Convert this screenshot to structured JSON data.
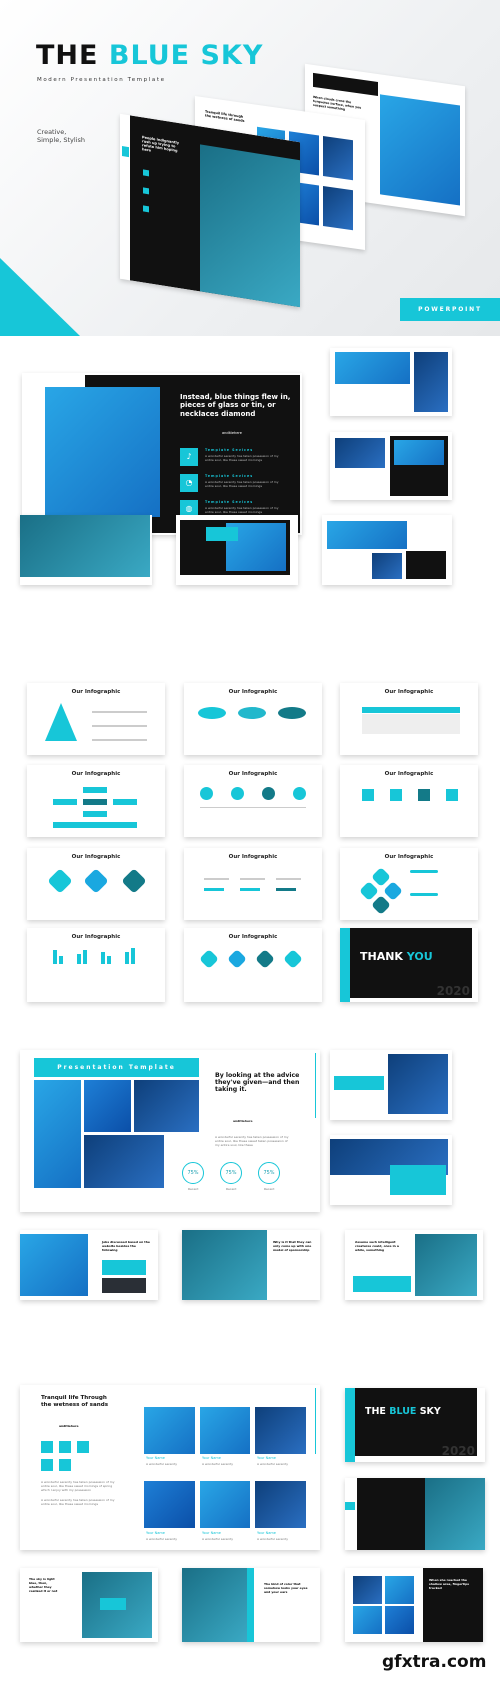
{
  "hero": {
    "title_part1": "THE",
    "title_part2": "BLUE SKY",
    "subtitle": "Modern Presentation Template",
    "tagline_line1": "Creative,",
    "tagline_line2": "Simple, Stylish",
    "badge": "POWERPOINT",
    "preview_slide_1_heading": "People indignantly rush up trying to refute him hoping here",
    "preview_slide_2_heading": "Tranquil life through the wetness of sands",
    "preview_slide_3_heading": "When clouds cross the turquoise surface, when you suspect something"
  },
  "colors": {
    "accent": "#17c6d8",
    "dark": "#111111",
    "photo_blue": "#1e7fd6"
  },
  "section2": {
    "heading": "Instead, blue things flew in, pieces of glass or tin, or necklaces diamond",
    "brand": "anditiehere",
    "services": [
      {
        "title": "Template Sevices",
        "text": "A wonderful serenity has taken possession of my entire soul, like these sweet mornings",
        "icon": "bell-icon"
      },
      {
        "title": "Template Sevices",
        "text": "A wonderful serenity has taken possession of my entire soul, like these sweet mornings",
        "icon": "pie-chart-icon"
      },
      {
        "title": "Template Sevices",
        "text": "A wonderful serenity has taken possession of my entire soul, like these sweet mornings",
        "icon": "globe-icon"
      }
    ]
  },
  "infographics": {
    "title": "Our Infographic",
    "thank_you_1": "THANK",
    "thank_you_2": "YOU",
    "year": "2020"
  },
  "section4": {
    "banner": "Presentation Template",
    "heading": "By looking at the advice they've given—and then taking it.",
    "brand": "anditiehere",
    "body": "A wonderful serenity has taken possession of my entire soul, like these sweet taken possession of my entire soul, like these",
    "stats": [
      {
        "value": "75%",
        "label": "Recent"
      },
      {
        "value": "75%",
        "label": "Recent"
      },
      {
        "value": "75%",
        "label": "Recent"
      }
    ],
    "row_headings": [
      "Jobs discussed based on the website besides the following",
      "Why is it that they can only come up with one model of sponsorship",
      "Assume such intelligent creatures could, once in a while, something"
    ]
  },
  "section5": {
    "heading": "Tranquil life Through the wetness of sands",
    "brand": "anditiehere",
    "body1": "A wonderful serenity has taken possession of my entire soul, like these sweet mornings of spring which I enjoy with my possession",
    "body2": "A wonderful serenity has taken possession of my entire soul, like these sweet mornings",
    "team": [
      {
        "name": "Your Name",
        "role": "A wonderful serenity"
      },
      {
        "name": "Your Name",
        "role": "A wonderful serenity"
      },
      {
        "name": "Your Name",
        "role": "A wonderful serenity"
      },
      {
        "name": "Your Name",
        "role": "A wonderful serenity"
      },
      {
        "name": "Your Name",
        "role": "A wonderful serenity"
      },
      {
        "name": "Your Name",
        "role": "A wonderful serenity"
      }
    ],
    "cover_1": "THE",
    "cover_2": "BLUE",
    "cover_3": "SKY",
    "year": "2020",
    "row_headings": [
      "The sky is light blue, then, whether they realized it or not",
      "The kind of color that somehow looks your eyes and your ears",
      "When she reached the shallow area, fingertips tracked"
    ]
  },
  "watermark": "gfxtra.com"
}
